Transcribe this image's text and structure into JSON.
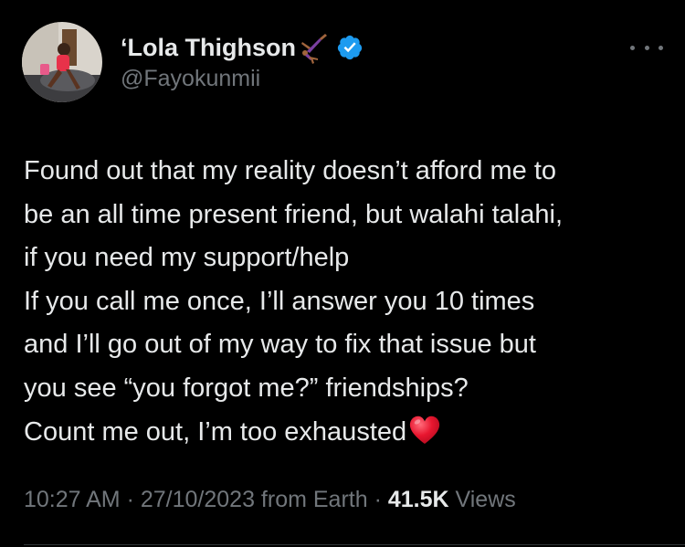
{
  "author": {
    "display_name": "‘Lola Thighson",
    "handle": "@Fayokunmii",
    "name_emoji": "gymnast-icon",
    "verified": true
  },
  "tweet": {
    "lines": [
      "Found out that my reality doesn’t afford me to",
      "be an all time present friend, but walahi talahi,",
      "if you need my support/help",
      "If you call me once, I’ll answer you 10 times",
      "and I’ll go out of my way to fix that issue but",
      "you see “you forgot me?” friendships?",
      "Count me out, I’m too exhausted"
    ],
    "trailing_emoji": "red-heart-icon"
  },
  "meta": {
    "time": "10:27 AM",
    "sep1": " · ",
    "date": "27/10/2023",
    "source": " from Earth",
    "sep2": " · ",
    "views_count": "41.5K",
    "views_label": " Views"
  },
  "colors": {
    "background": "#000000",
    "text_primary": "#e7e9ea",
    "text_secondary": "#71767b",
    "verified_blue": "#1d9bf0",
    "heart_red": "#e0112b"
  }
}
